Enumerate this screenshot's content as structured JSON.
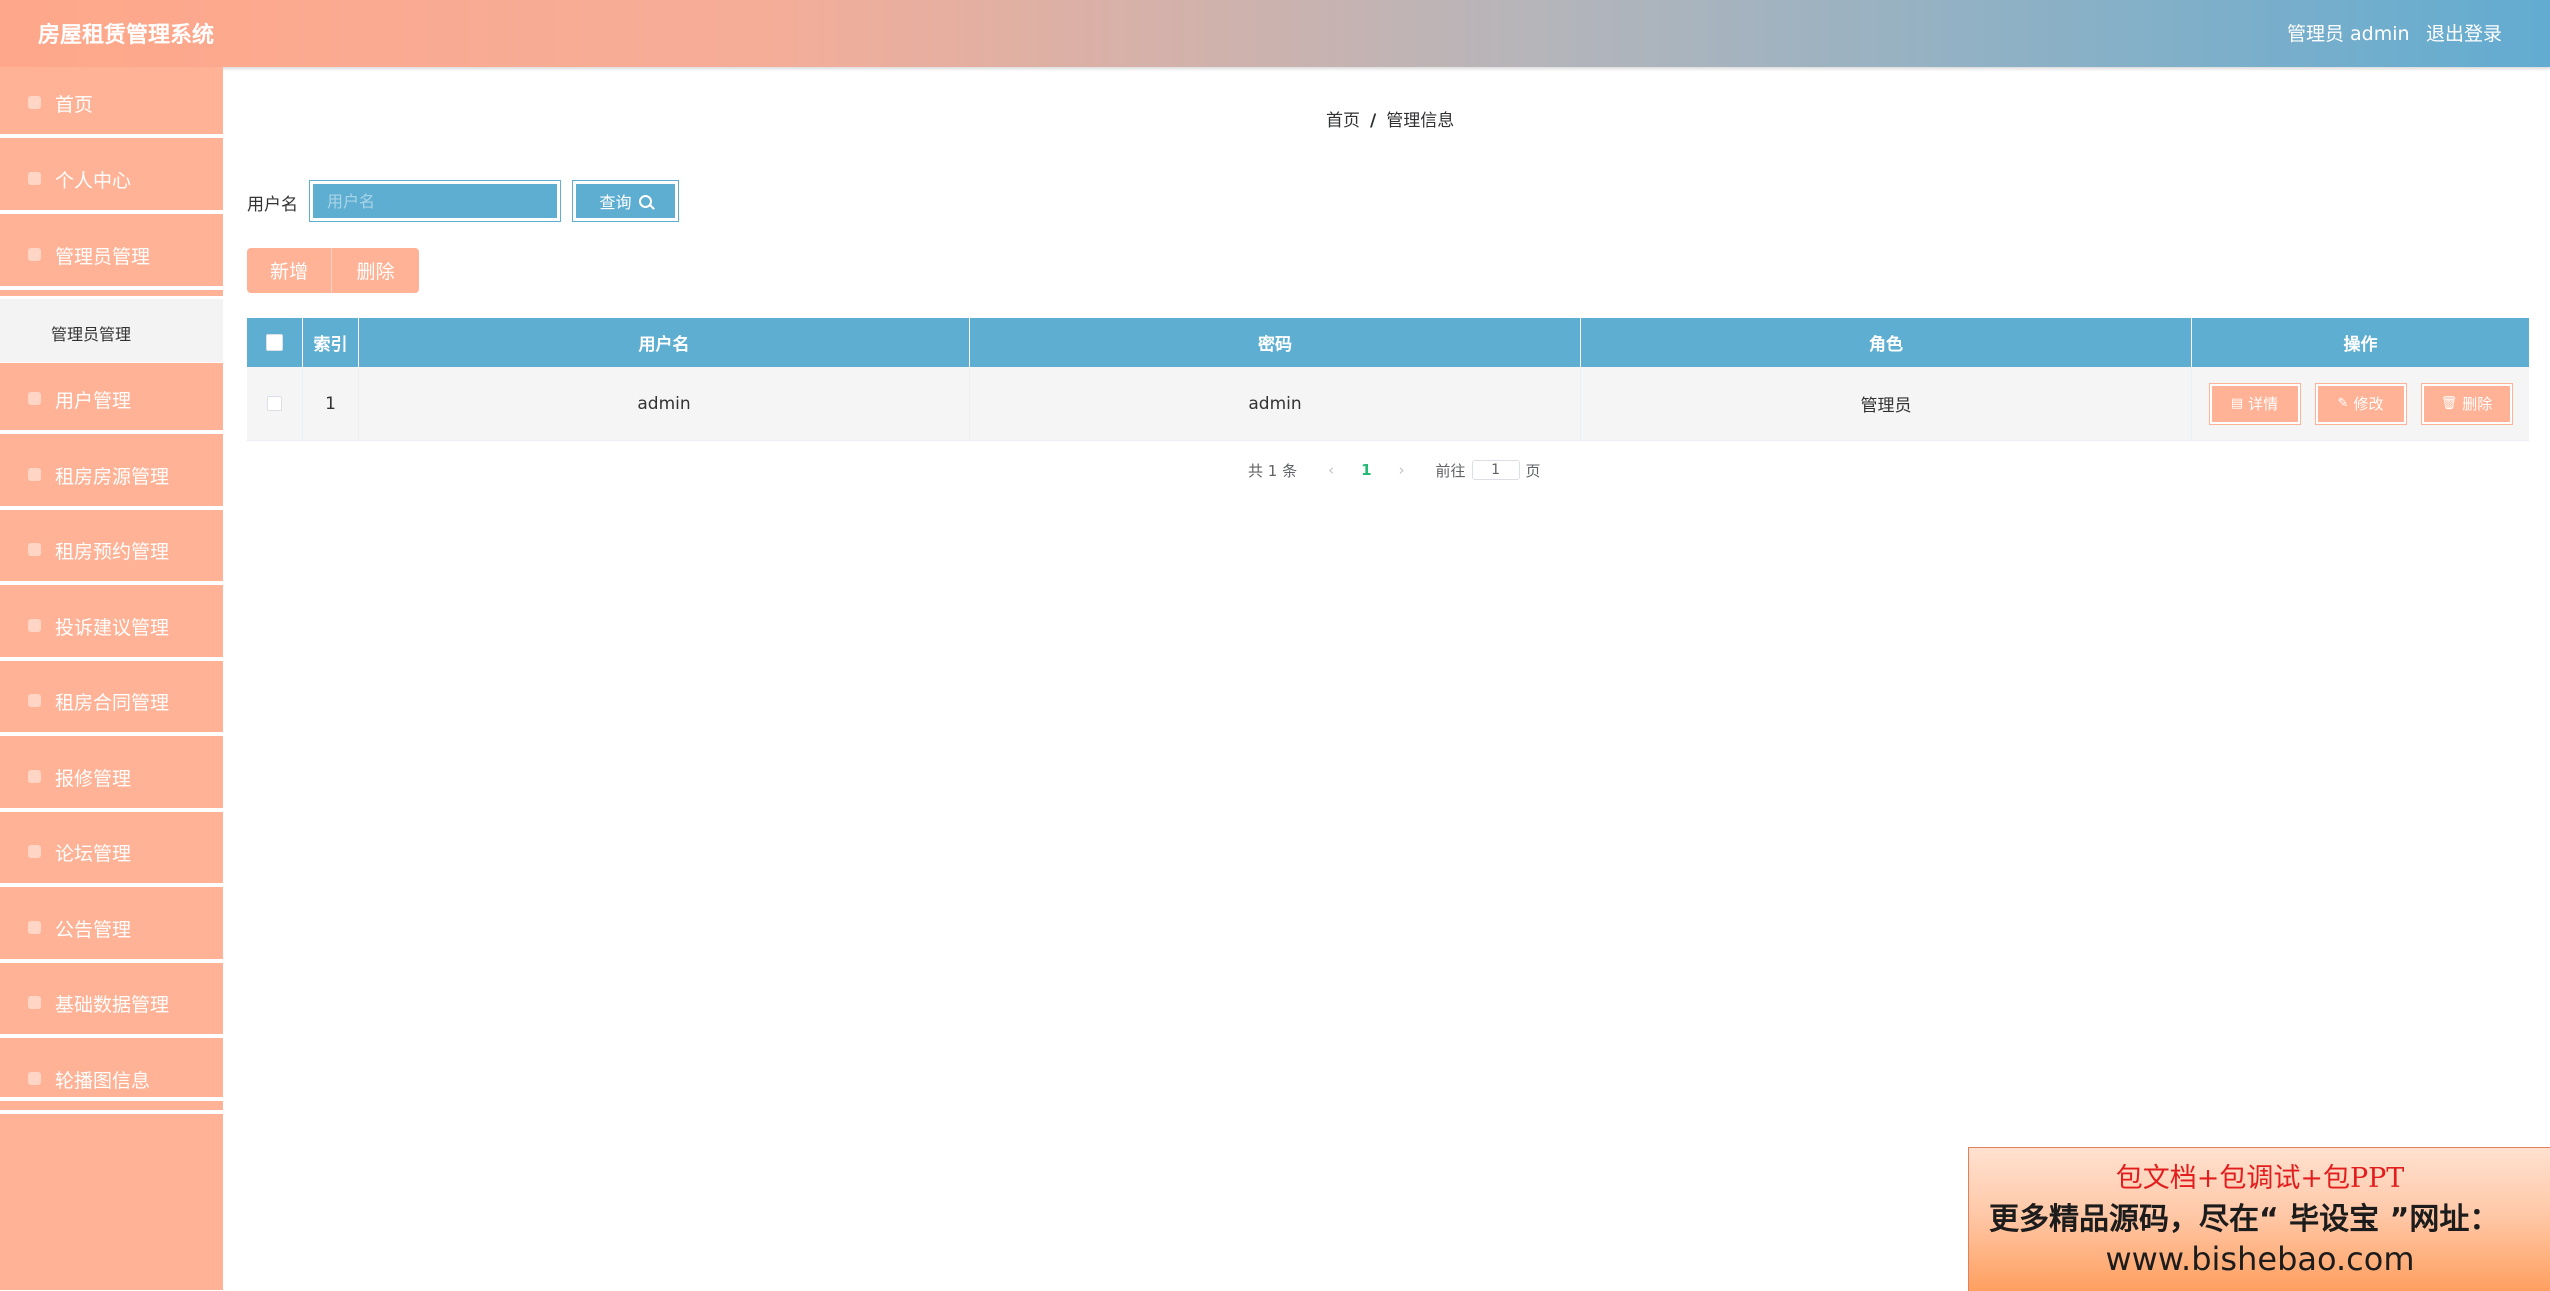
{
  "header": {
    "app_title": "房屋租赁管理系统",
    "admin_label": "管理员 admin",
    "logout": "退出登录"
  },
  "sidebar": {
    "items": [
      {
        "label": "首页",
        "icon": "home-icon"
      },
      {
        "label": "个人中心",
        "icon": "user-icon"
      },
      {
        "label": "管理员管理",
        "icon": "admin-icon"
      },
      {
        "label": "用户管理",
        "icon": "users-icon"
      },
      {
        "label": "租房房源管理",
        "icon": "house-icon"
      },
      {
        "label": "租房预约管理",
        "icon": "calendar-icon"
      },
      {
        "label": "投诉建议管理",
        "icon": "feedback-icon"
      },
      {
        "label": "租房合同管理",
        "icon": "contract-icon"
      },
      {
        "label": "报修管理",
        "icon": "repair-icon"
      },
      {
        "label": "论坛管理",
        "icon": "forum-icon"
      },
      {
        "label": "公告管理",
        "icon": "notice-icon"
      },
      {
        "label": "基础数据管理",
        "icon": "data-icon"
      },
      {
        "label": "轮播图信息",
        "icon": "carousel-icon"
      }
    ],
    "sub_item": "管理员管理"
  },
  "breadcrumb": {
    "home": "首页",
    "separator": "/",
    "current": "管理信息"
  },
  "search": {
    "label": "用户名",
    "placeholder": "用户名",
    "button": "查询"
  },
  "actions": {
    "add": "新增",
    "delete": "删除"
  },
  "table": {
    "headers": {
      "index": "索引",
      "username": "用户名",
      "password": "密码",
      "role": "角色",
      "operation": "操作"
    },
    "rows": [
      {
        "index": "1",
        "username": "admin",
        "password": "admin",
        "role": "管理员"
      }
    ],
    "row_buttons": {
      "detail": "详情",
      "edit": "修改",
      "delete": "删除"
    }
  },
  "pagination": {
    "total": "共 1 条",
    "current_page": "1",
    "goto_label": "前往",
    "goto_value": "1",
    "page_suffix": "页"
  },
  "ad": {
    "line1": "包文档+包调试+包PPT",
    "line2": "更多精品源码，尽在“ 毕设宝 ”网址：",
    "line3": "www.bishebao.com"
  },
  "colors": {
    "accent_salmon": "#ffb295",
    "accent_blue": "#5eaed2",
    "page_active": "#25b877"
  }
}
